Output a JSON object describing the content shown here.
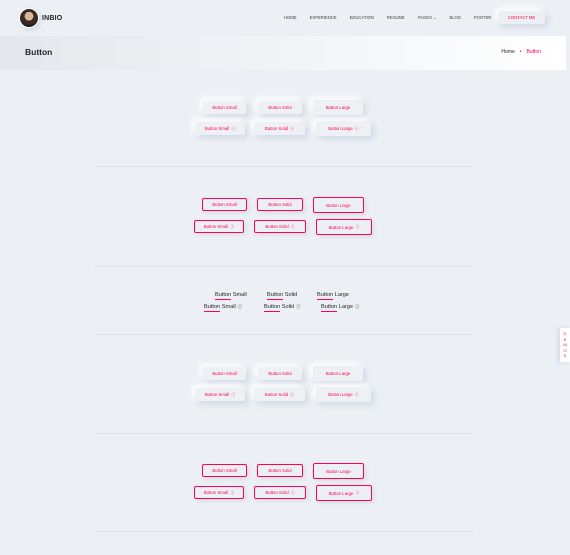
{
  "header": {
    "brand": "INBIO",
    "nav": [
      "HOME",
      "EXPERIENCE",
      "EDUCATION",
      "RESUME",
      "PAGES",
      "BLOG",
      "FOOTER"
    ],
    "contact_label": "CONTACT ME"
  },
  "banner": {
    "title": "Button",
    "crumb_home": "Home",
    "crumb_current": "Button"
  },
  "buttons": {
    "small": "Button Small",
    "solid": "Button Solid",
    "large": "Button Large",
    "icon": "ⓘ"
  },
  "demo_tab": [
    "D",
    "E",
    "M",
    "O",
    "S"
  ],
  "colors": {
    "accent": "#ff014f",
    "background": "#eceff3"
  }
}
